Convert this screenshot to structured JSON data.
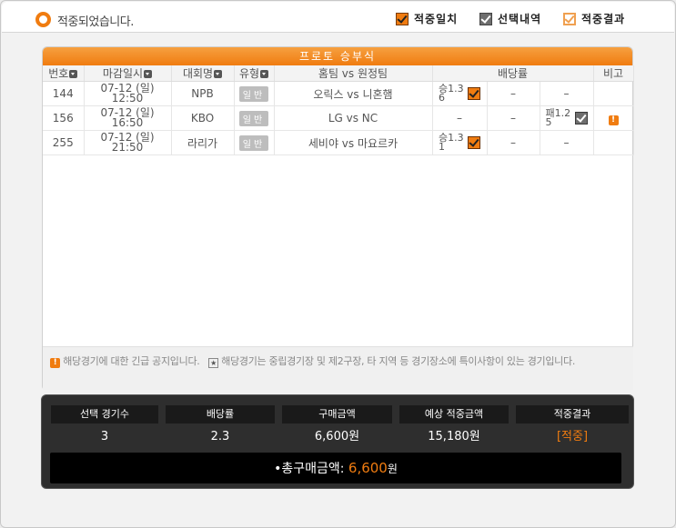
{
  "header": {
    "status_text": "적중되었습니다.",
    "legend": [
      {
        "label": "적중일치",
        "style": "orange-fill",
        "icon": "checkbox-orange-icon"
      },
      {
        "label": "선택내역",
        "style": "gray-fill",
        "icon": "checkbox-gray-icon"
      },
      {
        "label": "적중결과",
        "style": "orange-outline",
        "icon": "checkbox-outline-icon"
      }
    ]
  },
  "panel": {
    "title": "프로토 승부식",
    "columns": [
      "번호",
      "마감일시",
      "대회명",
      "유형",
      "홈팀 vs 원정팀",
      "배당률",
      "비고"
    ],
    "rows": [
      {
        "no": "144",
        "date": "07-12 (일)",
        "time": "12:50",
        "league": "NPB",
        "type": "일반",
        "match": "오릭스 vs 니혼햄",
        "odds": [
          "승1.36",
          "–",
          "–"
        ],
        "checked_col": 0,
        "check_style": "orange",
        "note": ""
      },
      {
        "no": "156",
        "date": "07-12 (일)",
        "time": "16:50",
        "league": "KBO",
        "type": "일반",
        "match": "LG vs NC",
        "odds": [
          "–",
          "–",
          "패1.25"
        ],
        "checked_col": 2,
        "check_style": "gray",
        "note": "!"
      },
      {
        "no": "255",
        "date": "07-12 (일)",
        "time": "21:50",
        "league": "라리가",
        "type": "일반",
        "match": "세비야 vs 마요르카",
        "odds": [
          "승1.31",
          "–",
          "–"
        ],
        "checked_col": 0,
        "check_style": "orange",
        "note": ""
      }
    ],
    "notice_alert": "해당경기에 대한 긴급 공지입니다.",
    "notice_star": "해당경기는 중립경기장 및 제2구장, 타 지역 등 경기장소에 특이사항이 있는 경기입니다."
  },
  "summary": {
    "headers": [
      "선택 경기수",
      "배당률",
      "구매금액",
      "예상 적중금액",
      "적중결과"
    ],
    "values": [
      "3",
      "2.3",
      "6,600원",
      "15,180원",
      "[적중]"
    ],
    "total_label": "•총구매금액:",
    "total_amount": "6,600",
    "total_unit": "원"
  },
  "colors": {
    "accent": "#f07c10",
    "dark": "#2e2e2e"
  }
}
